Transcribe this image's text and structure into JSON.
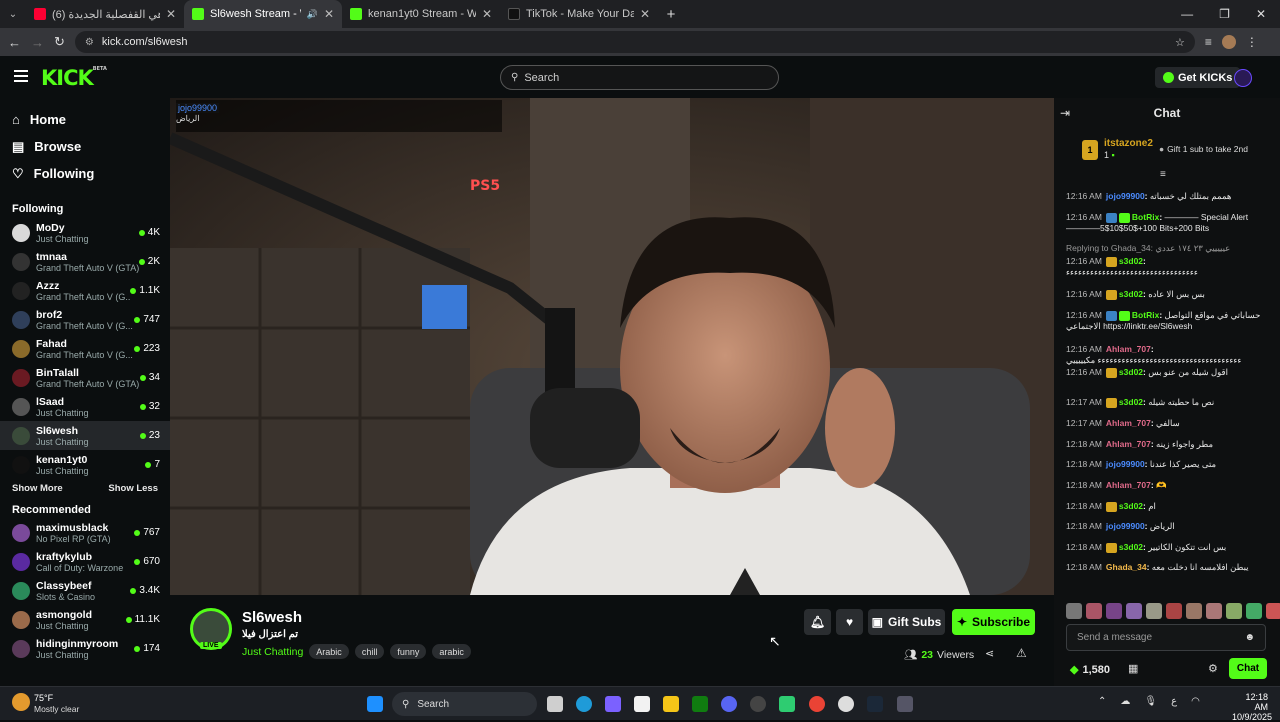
{
  "browser": {
    "tabs": [
      {
        "title": "(6) ملاهي القفصلية الجديدة !! - e",
        "color": "#ff0033"
      },
      {
        "title": "Sl6wesh Stream - Watch Live",
        "color": "#53fc18"
      },
      {
        "title": "kenan1yt0 Stream - Watch Live",
        "color": "#53fc18"
      },
      {
        "title": "TikTok - Make Your Day",
        "color": "#111111"
      }
    ],
    "url": "kick.com/sl6wesh"
  },
  "header": {
    "logo": "KICK",
    "logo_beta": "BETA",
    "search_placeholder": "Search",
    "get_kicks": "Get KICKs"
  },
  "sidebar": {
    "nav": [
      {
        "label": "Home",
        "icon": "home-icon"
      },
      {
        "label": "Browse",
        "icon": "browse-icon"
      },
      {
        "label": "Following",
        "icon": "heart-icon"
      }
    ],
    "following_title": "Following",
    "following": [
      {
        "name": "MoDy",
        "category": "Just Chatting",
        "viewers": "4K",
        "color": "#d9d9d9"
      },
      {
        "name": "tmnaa",
        "category": "Grand Theft Auto V (GTA)",
        "viewers": "2K",
        "color": "#333333"
      },
      {
        "name": "Azzz",
        "category": "Grand Theft Auto V (G...",
        "viewers": "1.1K",
        "color": "#222222"
      },
      {
        "name": "brof2",
        "category": "Grand Theft Auto V (G...",
        "viewers": "747",
        "color": "#2f3f5a"
      },
      {
        "name": "Fahad",
        "category": "Grand Theft Auto V (G...",
        "viewers": "223",
        "color": "#8a6a2a"
      },
      {
        "name": "BinTalall",
        "category": "Grand Theft Auto V (GTA)",
        "viewers": "34",
        "color": "#6a1a22"
      },
      {
        "name": "lSaad",
        "category": "Just Chatting",
        "viewers": "32",
        "color": "#555555"
      },
      {
        "name": "Sl6wesh",
        "category": "Just Chatting",
        "viewers": "23",
        "color": "#3a4b3a"
      },
      {
        "name": "kenan1yt0",
        "category": "Just Chatting",
        "viewers": "7",
        "color": "#111111"
      }
    ],
    "show_more": "Show More",
    "show_less": "Show Less",
    "recommended_title": "Recommended",
    "recommended": [
      {
        "name": "maximusblack",
        "category": "No Pixel RP (GTA)",
        "viewers": "767",
        "color": "#7a4a9a"
      },
      {
        "name": "kraftykylub",
        "category": "Call of Duty: Warzone",
        "viewers": "670",
        "color": "#5a2aa0"
      },
      {
        "name": "Classybeef",
        "category": "Slots & Casino",
        "viewers": "3.4K",
        "color": "#2a8a5a"
      },
      {
        "name": "asmongold",
        "category": "Just Chatting",
        "viewers": "11.1K",
        "color": "#9a6a4a"
      },
      {
        "name": "hidinginmyroom",
        "category": "Just Chatting",
        "viewers": "174",
        "color": "#5a3a5a"
      }
    ]
  },
  "video": {
    "overlay_user": "jojo99900",
    "overlay_text": "الرياض",
    "console_brand": "PS5"
  },
  "stream": {
    "channel": "Sl6wesh",
    "title": "تم اعتزال فيلا",
    "category": "Just Chatting",
    "tags": [
      "Arabic",
      "chill",
      "funny",
      "arabic"
    ],
    "live_label": "LIVE",
    "gift_subs": "Gift Subs",
    "subscribe": "Subscribe",
    "viewers": "23",
    "viewers_label": "Viewers"
  },
  "chat": {
    "title": "Chat",
    "pinned_user": "itstazone2",
    "pinned_count": "1",
    "pinned_rank": "1",
    "gift_prompt": "Gift 1 sub to take 2nd",
    "messages": [
      {
        "time": "12:16 AM",
        "user": "jojo99900",
        "color": "#4b8cff",
        "badges": [],
        "text": "هممم بمتلك لي خسباته"
      },
      {
        "time": "12:16 AM",
        "user": "BotRix",
        "color": "#53fc18",
        "badges": [
          "#3b82c4",
          "#53fc18"
        ],
        "text": "———— Special Alert ————5$10$50$+100 Bits+200 Bits"
      },
      {
        "time": "",
        "user": "",
        "color": "#999999",
        "badges": [],
        "text": "Replying to Ghada_34: عيييييي ٢٣ ١٧٤ عددي"
      },
      {
        "time": "12:16 AM",
        "user": "s3d02",
        "color": "#53fc18",
        "badges": [
          "#d6a520"
        ],
        "text": "ءءءءءءءءءءءءءءءءءءءءءءءءءءءءءءءءء"
      },
      {
        "time": "12:16 AM",
        "user": "s3d02",
        "color": "#53fc18",
        "badges": [
          "#d6a520"
        ],
        "text": "بس بس الا عاده"
      },
      {
        "time": "12:16 AM",
        "user": "BotRix",
        "color": "#53fc18",
        "badges": [
          "#3b82c4",
          "#53fc18"
        ],
        "text": "حساباتي في مواقع التواصل الاجتماعي https://linktr.ee/Sl6wesh"
      },
      {
        "time": "12:16 AM",
        "user": "Ahlam_707",
        "color": "#e06a8a",
        "badges": [],
        "text": "ءءءءءءءءءءءءءءءءءءءءءءءءءءءءءءءءءءءء مكيييييي"
      },
      {
        "time": "12:16 AM",
        "user": "s3d02",
        "color": "#53fc18",
        "badges": [
          "#d6a520"
        ],
        "text": "اقول شيله من عنو بس"
      },
      {
        "time": "12:17 AM",
        "user": "s3d02",
        "color": "#53fc18",
        "badges": [
          "#d6a520"
        ],
        "text": "نص ما حطيته شيله"
      },
      {
        "time": "12:17 AM",
        "user": "Ahlam_707",
        "color": "#e06a8a",
        "badges": [],
        "text": "سالفي"
      },
      {
        "time": "12:18 AM",
        "user": "Ahlam_707",
        "color": "#e06a8a",
        "badges": [],
        "text": "مطر واجواء زينه"
      },
      {
        "time": "12:18 AM",
        "user": "jojo99900",
        "color": "#4b8cff",
        "badges": [],
        "text": "متى يصير كذا عندنا"
      },
      {
        "time": "12:18 AM",
        "user": "Ahlam_707",
        "color": "#e06a8a",
        "badges": [],
        "text": "🫶"
      },
      {
        "time": "12:18 AM",
        "user": "s3d02",
        "color": "#53fc18",
        "badges": [
          "#d6a520"
        ],
        "text": "ام"
      },
      {
        "time": "12:18 AM",
        "user": "jojo99900",
        "color": "#4b8cff",
        "badges": [],
        "text": "الرياض"
      },
      {
        "time": "12:18 AM",
        "user": "s3d02",
        "color": "#53fc18",
        "badges": [
          "#d6a520"
        ],
        "text": "بس انت تتكون الكاتيير"
      },
      {
        "time": "12:18 AM",
        "user": "Ghada_34",
        "color": "#f2b84b",
        "badges": [],
        "text": "يبطن افلامسه انا دخلت معه"
      }
    ],
    "input_placeholder": "Send a message",
    "kicks_count": "1,580",
    "chat_button": "Chat"
  },
  "taskbar": {
    "weather_temp": "75°F",
    "weather_desc": "Mostly clear",
    "search_label": "Search",
    "time": "12:18 AM",
    "date": "10/9/2025"
  }
}
